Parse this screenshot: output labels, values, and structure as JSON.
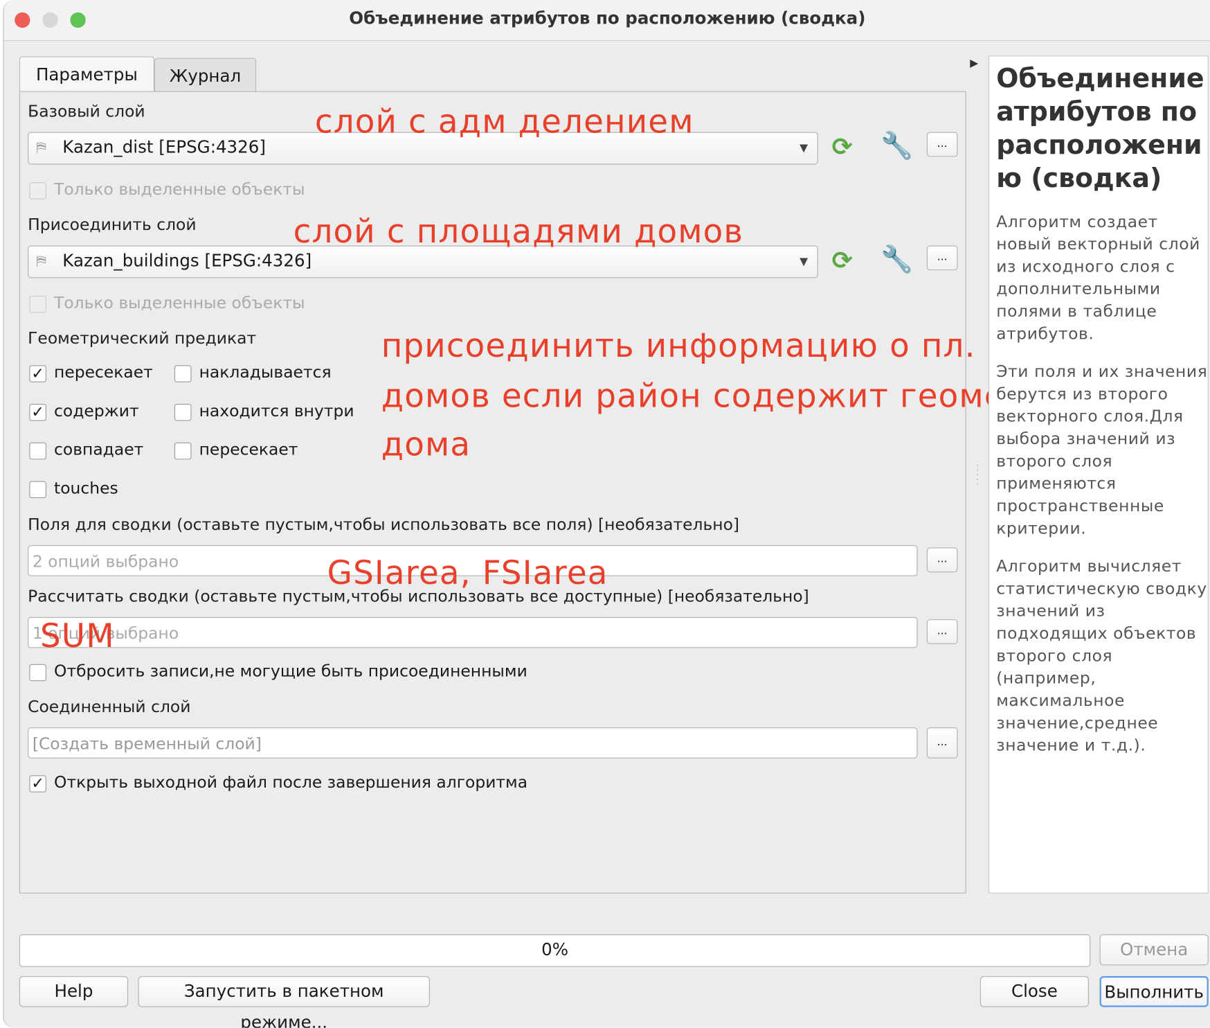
{
  "window": {
    "title": "Объединение атрибутов по расположению (сводка)"
  },
  "tabs": [
    {
      "label": "Параметры",
      "active": true
    },
    {
      "label": "Журнал",
      "active": false
    }
  ],
  "form": {
    "base_layer": {
      "label": "Базовый слой",
      "value": "Kazan_dist [EPSG:4326]",
      "selected_only": "Только выделенные объекты"
    },
    "join_layer": {
      "label": "Присоединить слой",
      "value": "Kazan_buildings [EPSG:4326]",
      "selected_only": "Только выделенные объекты"
    },
    "predicate": {
      "label": "Геометрический предикат",
      "options": [
        {
          "label": "пересекает",
          "checked": true
        },
        {
          "label": "накладывается",
          "checked": false
        },
        {
          "label": "содержит",
          "checked": true
        },
        {
          "label": "находится внутри",
          "checked": false
        },
        {
          "label": "совпадает",
          "checked": false
        },
        {
          "label": "пересекает",
          "checked": false
        },
        {
          "label": "touches",
          "checked": false
        }
      ]
    },
    "fields": {
      "label": "Поля для сводки (оставьте пустым,чтобы использовать все поля) [необязательно]",
      "placeholder": "2 опций выбрано"
    },
    "summaries": {
      "label": "Рассчитать сводки (оставьте пустым,чтобы использовать все доступные) [необязательно]",
      "placeholder": "1 опций выбрано"
    },
    "discard": {
      "label": "Отбросить записи,не могущие быть присоединенными",
      "checked": false
    },
    "output": {
      "label": "Соединенный слой",
      "placeholder": "[Создать временный слой]"
    },
    "open_output": {
      "label": "Открыть выходной файл после завершения алгоритма",
      "checked": true
    },
    "dots": "...",
    "check_mark": "✓"
  },
  "annotations": {
    "base": "слой с адм делением",
    "join": "слой с площадями домов",
    "predicate_lines": [
      "присоединить информацию о пл.",
      "домов если район содержит геометрию",
      "дома"
    ],
    "fields": "GSIarea, FSIarea",
    "summaries": "SUM",
    "color": "#e8402a"
  },
  "help": {
    "title": "Объединение атрибутов по расположени ю (сводка)",
    "paragraphs": [
      [
        "Алгоритм создает",
        "новый векторный слой",
        "из исходного слоя с",
        "дополнительными",
        "полями в таблице",
        "атрибутов."
      ],
      [
        "Эти поля и их значения",
        "берутся из второго",
        "векторного слоя.Для",
        "выбора значений из",
        "второго слоя",
        "применяются",
        "пространственные",
        "критерии."
      ],
      [
        "Алгоритм вычисляет",
        "статистическую сводку",
        "значений из",
        "подходящих объектов",
        "второго слоя",
        "(например,",
        "максимальное",
        "значение,среднее",
        "значение и т.д.)."
      ]
    ]
  },
  "footer": {
    "progress_text": "0%",
    "progress": 0,
    "cancel": "Отмена",
    "help": "Help",
    "batch": "Запустить в пакетном режиме...",
    "close": "Close",
    "run": "Выполнить"
  }
}
